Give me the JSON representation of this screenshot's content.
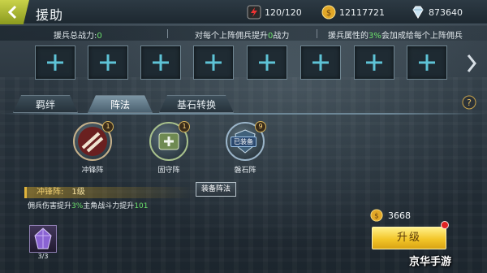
{
  "header": {
    "title": "援助",
    "stamina": "120/120",
    "gold": "12117721",
    "diamonds": "873640",
    "icons": {
      "back": "back-chevron-icon",
      "stamina": "lightning-icon",
      "gold": "gold-coin-icon",
      "diamond": "diamond-icon"
    }
  },
  "info_bar": {
    "total_power_label": "援兵总战力:",
    "total_power_value": "0",
    "per_unit_pre": "对每个上阵佣兵提升",
    "per_unit_value": "0",
    "per_unit_post": "战力",
    "attr_pre": "援兵属性的",
    "attr_value": "3%",
    "attr_post": "会加成给每个上阵佣兵"
  },
  "slots": [
    {
      "icon": "plus-icon"
    },
    {
      "icon": "plus-icon"
    },
    {
      "icon": "plus-icon"
    },
    {
      "icon": "plus-icon"
    },
    {
      "icon": "plus-icon"
    },
    {
      "icon": "plus-icon"
    },
    {
      "icon": "plus-icon"
    },
    {
      "icon": "plus-icon"
    }
  ],
  "tabs": [
    {
      "label": "羁绊",
      "active": false
    },
    {
      "label": "阵法",
      "active": true
    },
    {
      "label": "基石转换",
      "active": false
    }
  ],
  "formations": [
    {
      "label": "冲锋阵",
      "level": "1",
      "icon": "charge-icon"
    },
    {
      "label": "固守阵",
      "level": "1",
      "icon": "medkit-icon"
    },
    {
      "label": "磐石阵",
      "level": "9",
      "icon": "shield-icon",
      "status": "已装备"
    }
  ],
  "equip_button": "装备阵法",
  "detail": {
    "name": "冲锋阵:",
    "level": "1级",
    "desc_pre": "佣兵伤害提升",
    "desc_value1": "3%",
    "desc_mid": "主角战斗力提升",
    "desc_value2": "101"
  },
  "material": {
    "count": "3/3",
    "icon": "purple-crystal-icon"
  },
  "upgrade": {
    "cost": "3668",
    "label": "升级"
  },
  "watermark": "京华手游",
  "colors": {
    "highlight_green": "#6be06b",
    "gold_button": "#f3c629",
    "accent_yellow": "#e0b43c"
  }
}
